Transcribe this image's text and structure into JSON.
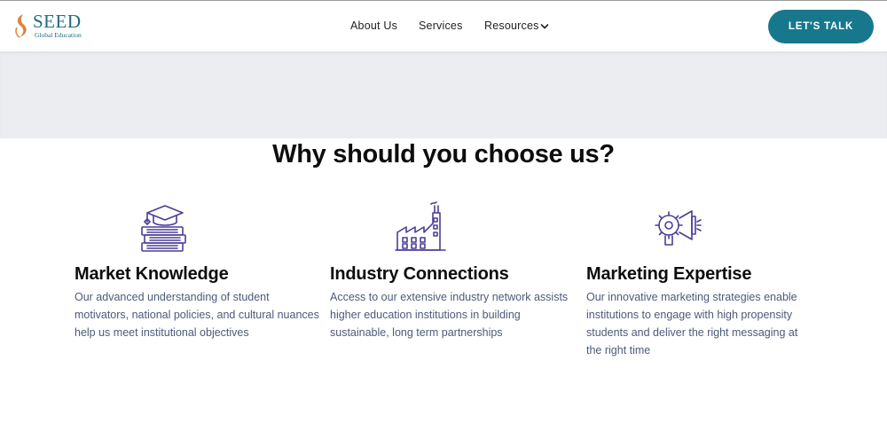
{
  "brand": {
    "name": "SEED",
    "tagline": "Global Education",
    "colors": {
      "primary": "#17788d",
      "logo_accent": "#e0823c",
      "icon_stroke": "#4b3e96"
    }
  },
  "nav": {
    "items": [
      {
        "label": "About Us"
      },
      {
        "label": "Services"
      },
      {
        "label": "Resources"
      }
    ],
    "cta_label": "LET'S TALK"
  },
  "section": {
    "title": "Why should you choose us?"
  },
  "features": [
    {
      "icon": "graduation-cap-books-icon",
      "title": "Market Knowledge",
      "body": "Our advanced understanding of student motivators, national policies, and cultural nuances help us meet institutional objectives"
    },
    {
      "icon": "factory-icon",
      "title": "Industry Connections",
      "body": "Access to our extensive industry network assists higher education institutions in building sustainable, long term partnerships"
    },
    {
      "icon": "megaphone-gear-icon",
      "title": "Marketing Expertise",
      "body": "Our innovative marketing strategies enable institutions to engage with high propensity students and deliver the right messaging at the right time"
    }
  ]
}
